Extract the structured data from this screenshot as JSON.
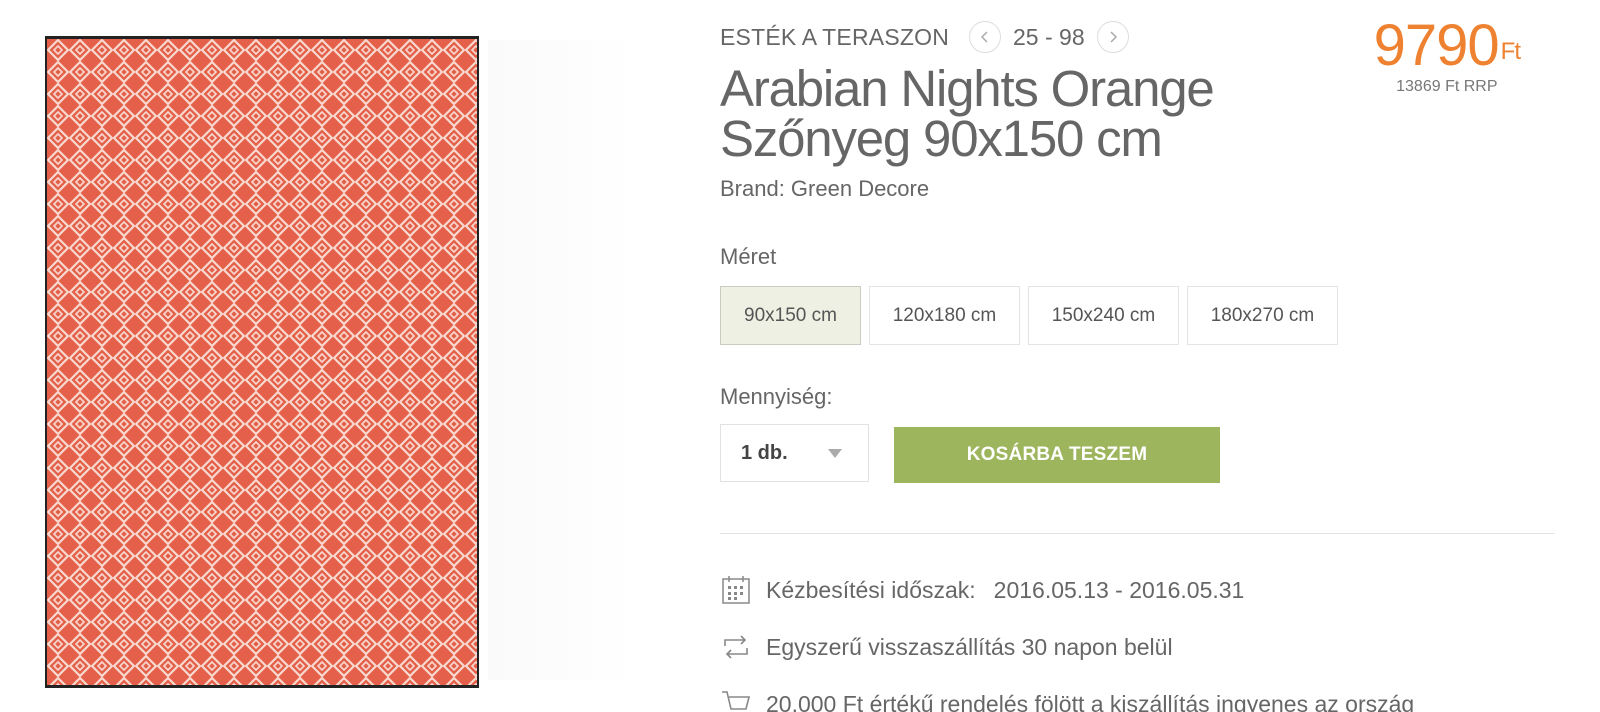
{
  "product": {
    "category": "ESTÉK A TERASZON",
    "counter": "25 - 98",
    "title_line1": "Arabian Nights Orange",
    "title_line2": "Szőnyeg 90x150 cm",
    "brand": "Brand: Green Decore",
    "price": "9790",
    "currency": "Ft",
    "rrp": "13869 Ft RRP",
    "image_icon": "rug-product-image"
  },
  "size": {
    "label": "Méret",
    "options": [
      "90x150 cm",
      "120x180 cm",
      "150x240 cm",
      "180x270 cm"
    ],
    "selected": "90x150 cm"
  },
  "quantity": {
    "label": "Mennyiség:",
    "value": "1 db."
  },
  "cart": {
    "button_label": "KOSÁRBA TESZEM"
  },
  "features": {
    "delivery_label": "Kézbesítési időszak:",
    "delivery_value": "2016.05.13 - 2016.05.31",
    "return_text": "Egyszerű visszaszállítás 30 napon belül",
    "shipping_text": "20.000 Ft értékű rendelés fölött a kiszállítás ingyenes az ország"
  },
  "colors": {
    "price": "#ee8230",
    "cart_button": "#9db55d",
    "selected_size_bg": "#eef0e3",
    "rug_orange": "#e4604a",
    "rug_pattern": "#f7d9cf"
  }
}
